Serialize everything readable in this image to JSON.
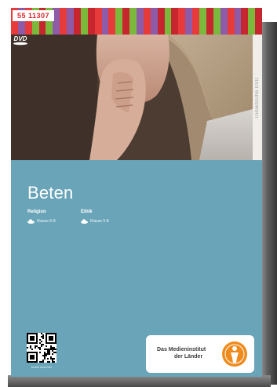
{
  "product_id": "55 11307",
  "dvd_mark": "DVD",
  "series_label": "Didaktische DVD",
  "title": "Beten",
  "meta": [
    {
      "label": "Religion",
      "value": "Klasse 5-8"
    },
    {
      "label": "Ethik",
      "value": "Klasse 5-8"
    }
  ],
  "qr_caption": "Inhalt ansehen",
  "publisher": {
    "line1": "Das Medieninstitut",
    "line2": "der Länder"
  },
  "colors": {
    "cover_background": "#6aa4b8",
    "id_text": "#d9262b",
    "logo_badge": "#f08a1c",
    "stripe_palette": [
      "#e73a3a",
      "#f7c21b",
      "#2f9bd6",
      "#7bb93d",
      "#e9578e",
      "#f28a1d",
      "#8d5ba8",
      "#29b3a8",
      "#d2d22a",
      "#c7262f",
      "#4a6fc0",
      "#f4a6b7"
    ]
  },
  "icons": {
    "dvd": "dvd-logo-icon",
    "meta": "cloud-icon",
    "publisher": "person-medallion-icon",
    "code": "qr-code-icon"
  }
}
